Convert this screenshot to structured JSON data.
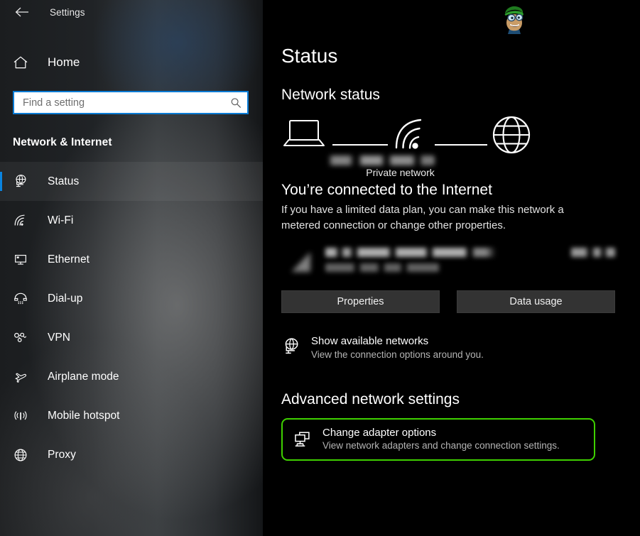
{
  "window": {
    "title": "Settings",
    "back_icon": "back-arrow-icon"
  },
  "sidebar": {
    "home": {
      "label": "Home",
      "icon": "home-icon"
    },
    "search": {
      "placeholder": "Find a setting",
      "value": "",
      "icon": "search-icon"
    },
    "category": "Network & Internet",
    "items": [
      {
        "label": "Status",
        "icon": "network-status-icon",
        "selected": true
      },
      {
        "label": "Wi-Fi",
        "icon": "wifi-icon",
        "selected": false
      },
      {
        "label": "Ethernet",
        "icon": "ethernet-icon",
        "selected": false
      },
      {
        "label": "Dial-up",
        "icon": "dialup-phone-icon",
        "selected": false
      },
      {
        "label": "VPN",
        "icon": "vpn-icon",
        "selected": false
      },
      {
        "label": "Airplane mode",
        "icon": "airplane-icon",
        "selected": false
      },
      {
        "label": "Mobile hotspot",
        "icon": "hotspot-icon",
        "selected": false
      },
      {
        "label": "Proxy",
        "icon": "globe-icon",
        "selected": false
      }
    ],
    "accent_color": "#0a84e0"
  },
  "main": {
    "page_title": "Status",
    "network_status_heading": "Network status",
    "diagram": {
      "device_icon": "laptop-icon",
      "link_icon": "wifi-signal-icon",
      "internet_icon": "globe-icon",
      "ssid": "",
      "network_type_label": "Private network"
    },
    "connection": {
      "title": "You’re connected to the Internet",
      "description": "If you have a limited data plan, you can make this network a metered connection or change other properties."
    },
    "usage": {
      "icon": "data-usage-icon",
      "network_name": "",
      "period": "",
      "amount": ""
    },
    "buttons": {
      "properties": "Properties",
      "data_usage": "Data usage"
    },
    "show_networks": {
      "icon": "network-status-icon",
      "title": "Show available networks",
      "subtitle": "View the connection options around you."
    },
    "advanced_heading": "Advanced network settings",
    "change_adapter": {
      "icon": "adapter-options-icon",
      "title": "Change adapter options",
      "subtitle": "View network adapters and change connection settings.",
      "highlight_color": "#3fd000"
    }
  },
  "watermark": {
    "icon": "mascot-avatar-icon"
  }
}
